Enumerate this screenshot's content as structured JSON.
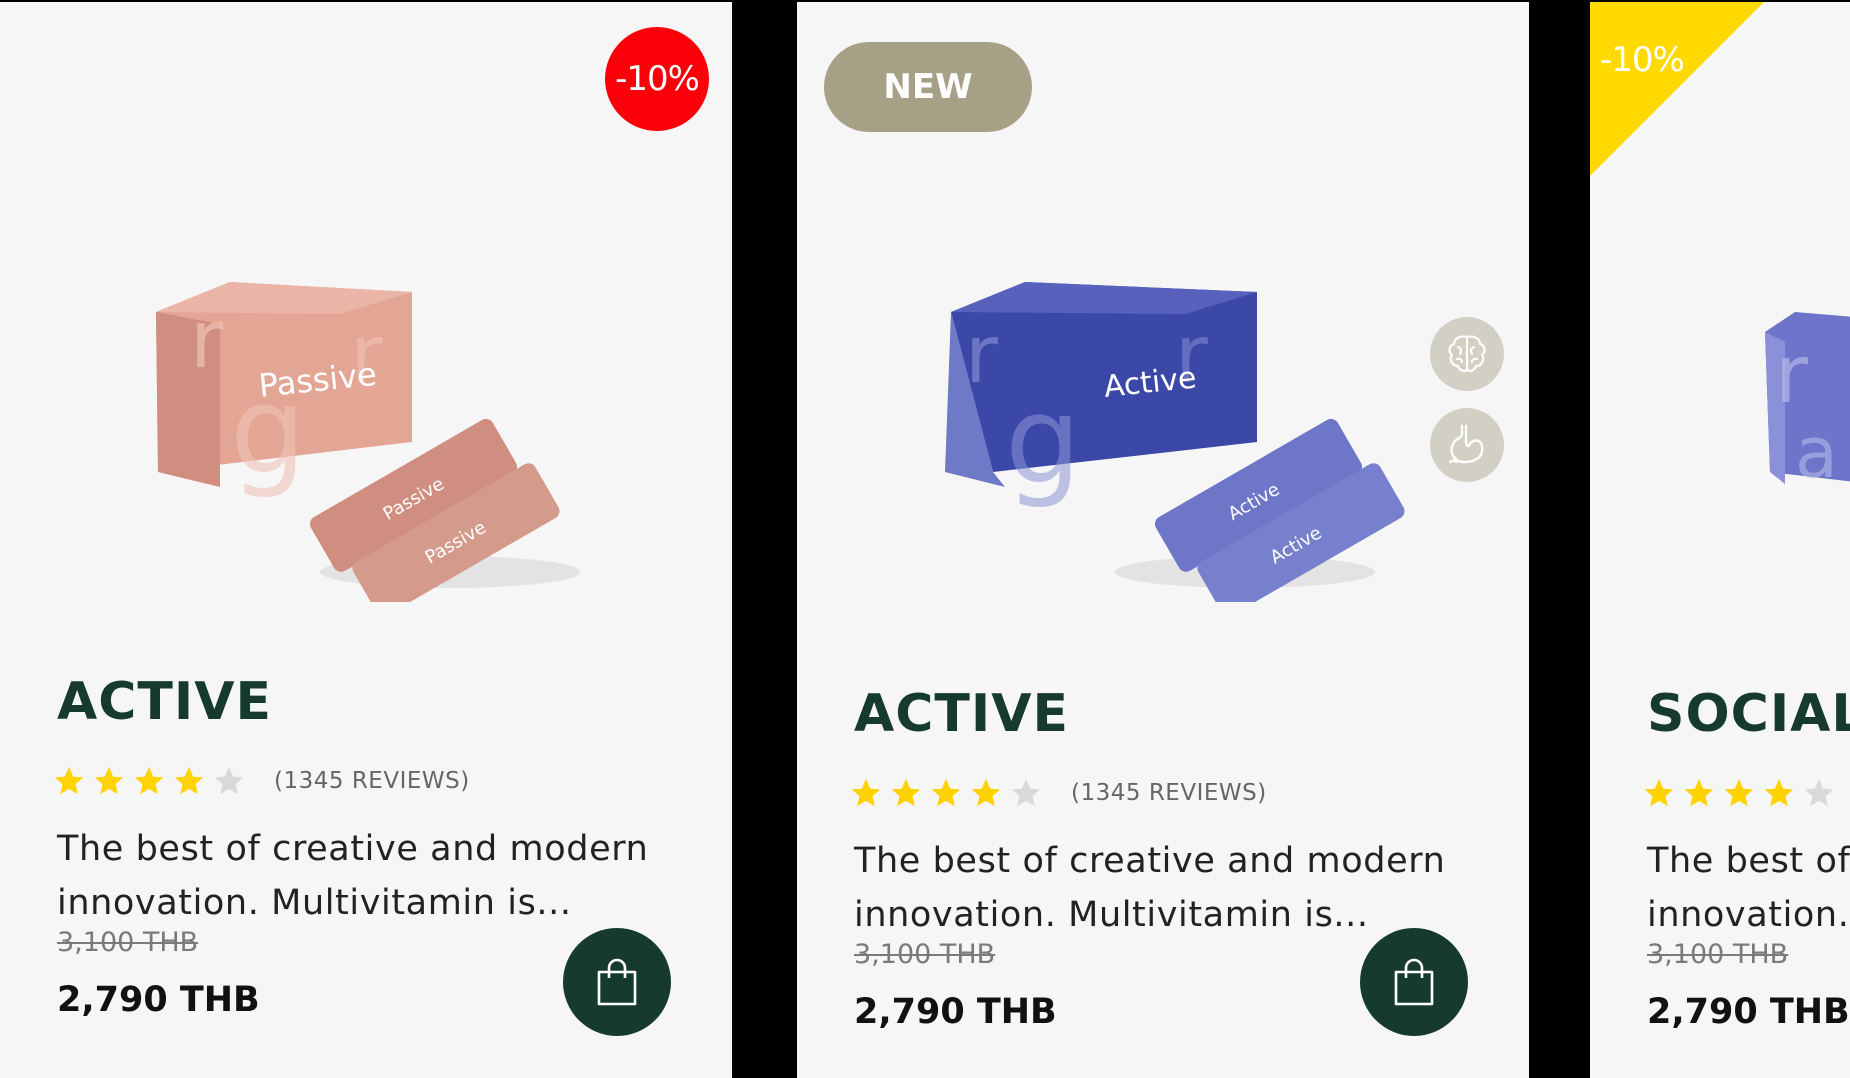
{
  "cards": [
    {
      "badge": "-10%",
      "box_label": "Passive",
      "sachet_label": "Passive",
      "box_color": "#d9968a",
      "title": "ACTIVE",
      "rating": 4,
      "reviews": "(1345 REVIEWS)",
      "desc_line1": "The best of creative and modern",
      "desc_line2": "innovation. Multivitamin is...",
      "old_price": "3,100 THB",
      "price": "2,790 THB"
    },
    {
      "badge": "NEW",
      "box_label": "Active",
      "sachet_label": "Active",
      "box_color": "#4a55b0",
      "title": "ACTIVE",
      "rating": 4,
      "reviews": "(1345 REVIEWS)",
      "desc_line1": "The best of creative and modern",
      "desc_line2": "innovation. Multivitamin is...",
      "old_price": "3,100 THB",
      "price": "2,790 THB",
      "benefit_icons": [
        "brain-icon",
        "stomach-icon"
      ]
    },
    {
      "badge": "-10%",
      "title": "SOCIALI",
      "rating": 4,
      "desc_line1": "The best of",
      "desc_line2": "innovation. M",
      "old_price": "3,100 THB",
      "price": "2,790 THB"
    }
  ],
  "icons": {
    "cart": "shopping-bag-icon",
    "star": "star-icon"
  },
  "colors": {
    "brand_dark": "#173a30",
    "star_filled": "#ffd200",
    "star_empty": "#d9d9d9",
    "sale_red": "#fb0008",
    "new_badge": "#a6a087",
    "sale_yellow": "#ffd900"
  }
}
